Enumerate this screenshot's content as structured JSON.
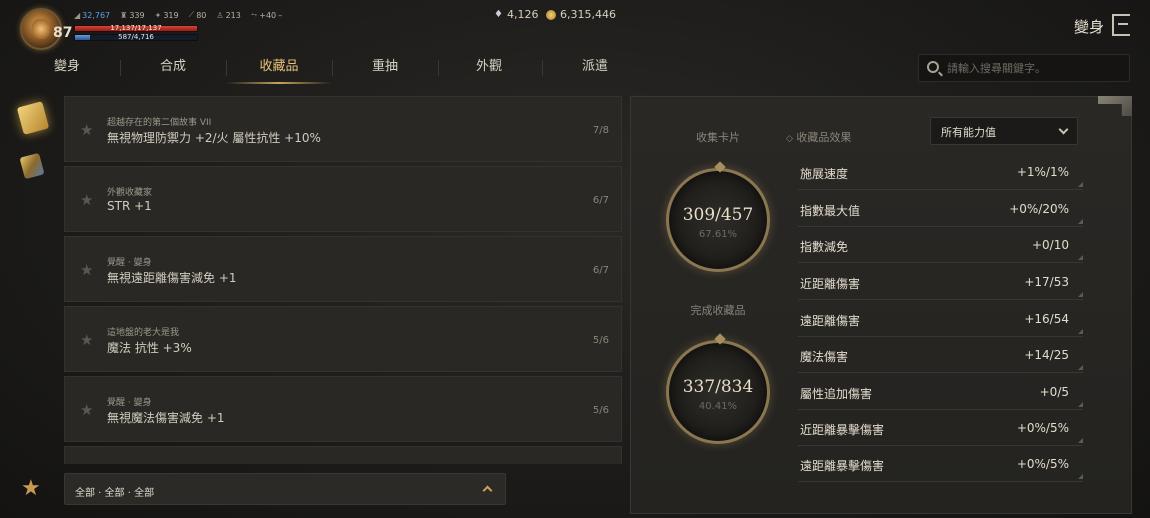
{
  "player": {
    "level": "87",
    "stats": [
      {
        "icon": "feather-icon",
        "value": "32,767"
      },
      {
        "icon": "helmet-icon",
        "value": "339"
      },
      {
        "icon": "claw-icon",
        "value": "319"
      },
      {
        "icon": "sword-icon",
        "value": "80"
      },
      {
        "icon": "person-icon",
        "value": "213"
      },
      {
        "icon": "wing-icon",
        "value": "+40"
      },
      {
        "icon": "dash-icon",
        "value": "–"
      }
    ],
    "hp_text": "17,137/17,137",
    "hp_fraction": 1.0,
    "mp_text": "587/4,716",
    "mp_fraction": 0.124
  },
  "currency": {
    "diamonds": "4,126",
    "gold": "6,315,446"
  },
  "header": {
    "title": "變身"
  },
  "tabs": [
    {
      "label": "變身",
      "active": false
    },
    {
      "label": "合成",
      "active": false
    },
    {
      "label": "收藏品",
      "active": true
    },
    {
      "label": "重抽",
      "active": false
    },
    {
      "label": "外觀",
      "active": false
    },
    {
      "label": "派遣",
      "active": false
    }
  ],
  "search": {
    "placeholder": "請輸入搜尋關鍵字。"
  },
  "collections": [
    {
      "subtitle": "超越存在的第二個故事 VII",
      "effect": "無視物理防禦力 +2/火 屬性抗性 +10%",
      "count": "7/8"
    },
    {
      "subtitle": "外觀收藏家",
      "effect": "STR +1",
      "count": "6/7"
    },
    {
      "subtitle": "覺醒 · 變身",
      "effect": "無視遠距離傷害減免 +1",
      "count": "6/7"
    },
    {
      "subtitle": "這地盤的老大是我",
      "effect": "魔法 抗性 +3%",
      "count": "5/6"
    },
    {
      "subtitle": "覺醒 · 變身",
      "effect": "無視魔法傷害減免 +1",
      "count": "5/6"
    }
  ],
  "filter": {
    "text": "全部 · 全部 · 全部"
  },
  "summary": {
    "cards_label": "收集卡片",
    "cards_value": "309/457",
    "cards_percent": "67.61%",
    "collections_label": "完成收藏品",
    "collections_value": "337/834",
    "collections_percent": "40.41%",
    "effects_label": "收藏品效果",
    "effects_dropdown": "所有能力值"
  },
  "effects": [
    {
      "name": "施展速度",
      "value": "+1%/1%"
    },
    {
      "name": "指數最大值",
      "value": "+0%/20%"
    },
    {
      "name": "指數減免",
      "value": "+0/10"
    },
    {
      "name": "近距離傷害",
      "value": "+17/53"
    },
    {
      "name": "遠距離傷害",
      "value": "+16/54"
    },
    {
      "name": "魔法傷害",
      "value": "+14/25"
    },
    {
      "name": "屬性追加傷害",
      "value": "+0/5"
    },
    {
      "name": "近距離暴擊傷害",
      "value": "+0%/5%"
    },
    {
      "name": "遠距離暴擊傷害",
      "value": "+0%/5%"
    }
  ]
}
